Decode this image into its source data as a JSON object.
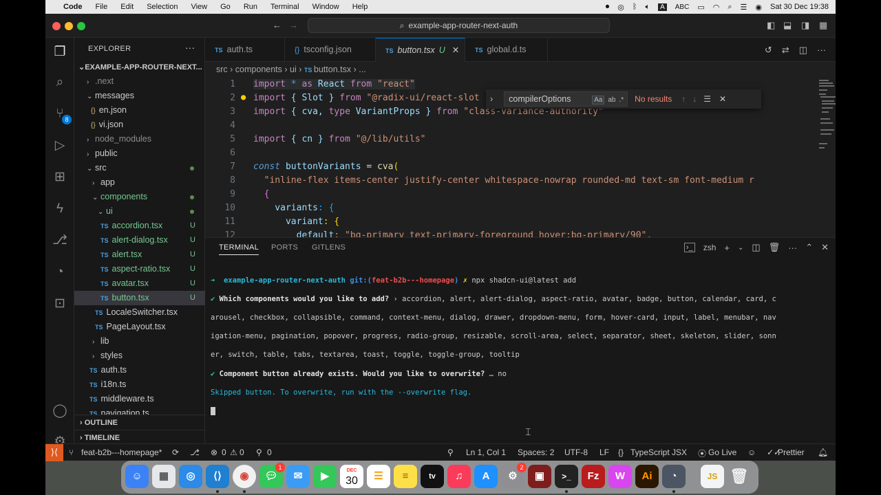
{
  "menubar": {
    "app": "Code",
    "items": [
      "File",
      "Edit",
      "Selection",
      "View",
      "Go",
      "Run",
      "Terminal",
      "Window",
      "Help"
    ],
    "input_source": "ABC",
    "clock": "Sat 30 Dec  19:38"
  },
  "titlebar": {
    "search": "example-app-router-next-auth"
  },
  "activity": {
    "scm_badge": "8"
  },
  "sidebar": {
    "title": "EXPLORER",
    "root": "EXAMPLE-APP-ROUTER-NEXT...",
    "tree": [
      {
        "label": ".next",
        "type": "folder",
        "open": false
      },
      {
        "label": "messages",
        "type": "folder",
        "open": true
      },
      {
        "label": "en.json",
        "type": "json"
      },
      {
        "label": "vi.json",
        "type": "json"
      },
      {
        "label": "node_modules",
        "type": "folder",
        "open": false
      },
      {
        "label": "public",
        "type": "folder",
        "open": false
      },
      {
        "label": "src",
        "type": "folder",
        "open": true
      },
      {
        "label": "app",
        "type": "folder",
        "open": false
      },
      {
        "label": "components",
        "type": "folder",
        "open": true
      },
      {
        "label": "ui",
        "type": "folder",
        "open": true
      },
      {
        "label": "accordion.tsx",
        "type": "ts",
        "status": "U"
      },
      {
        "label": "alert-dialog.tsx",
        "type": "ts",
        "status": "U"
      },
      {
        "label": "alert.tsx",
        "type": "ts",
        "status": "U"
      },
      {
        "label": "aspect-ratio.tsx",
        "type": "ts",
        "status": "U"
      },
      {
        "label": "avatar.tsx",
        "type": "ts",
        "status": "U"
      },
      {
        "label": "button.tsx",
        "type": "ts",
        "status": "U"
      },
      {
        "label": "LocaleSwitcher.tsx",
        "type": "ts"
      },
      {
        "label": "PageLayout.tsx",
        "type": "ts"
      },
      {
        "label": "lib",
        "type": "folder",
        "open": false
      },
      {
        "label": "styles",
        "type": "folder",
        "open": false
      },
      {
        "label": "auth.ts",
        "type": "ts"
      },
      {
        "label": "i18n.ts",
        "type": "ts"
      },
      {
        "label": "middleware.ts",
        "type": "ts"
      },
      {
        "label": "navigation.ts",
        "type": "ts"
      }
    ],
    "outline": "OUTLINE",
    "timeline": "TIMELINE"
  },
  "tabs": [
    {
      "icon": "TS",
      "label": "auth.ts"
    },
    {
      "icon": "{}",
      "label": "tsconfig.json"
    },
    {
      "icon": "TS",
      "label": "button.tsx",
      "status": "U",
      "close": "✕"
    },
    {
      "icon": "TS",
      "label": "global.d.ts"
    }
  ],
  "breadcrumb": [
    "src",
    "components",
    "ui",
    "button.tsx",
    "..."
  ],
  "find": {
    "query": "compilerOptions",
    "opt_case": "Aa",
    "opt_word": "ab",
    "opt_regex": ".*",
    "result": "No results"
  },
  "code_lines": [
    "1",
    "2",
    "3",
    "4",
    "5",
    "6",
    "7",
    "8",
    "9",
    "10",
    "11",
    "12"
  ],
  "code": {
    "l1a": "import",
    "l1b": " * ",
    "l1c": "as",
    "l1d": " React ",
    "l1e": "from",
    "l1f": " \"react\"",
    "l2a": "import",
    "l2b": " { Slot } ",
    "l2c": "from",
    "l2d": " \"@radix-ui/react-slot",
    "l3a": "import",
    "l3b": " { cva, ",
    "l3c": "type",
    "l3d": " VariantProps } ",
    "l3e": "from",
    "l3f": " \"class-variance-authority\"",
    "l5a": "import",
    "l5b": " { cn } ",
    "l5c": "from",
    "l5d": " \"@/lib/utils\"",
    "l7a": "const",
    "l7b": " buttonVariants ",
    "l7c": "= ",
    "l7d": "cva",
    "l7e": "(",
    "l8": "  \"inline-flex items-center justify-center whitespace-nowrap rounded-md text-sm font-medium r",
    "l9": "  {",
    "l10a": "    variants",
    "l10b": ": {",
    "l11a": "      variant",
    "l11b": ": {",
    "l12a": "        default",
    "l12b": ": \"bg-primary text-primary-foreground hover:bg-primary/90\","
  },
  "panel": {
    "tabs": [
      "TERMINAL",
      "PORTS",
      "GITLENS"
    ],
    "shell": "zsh"
  },
  "terminal": {
    "prompt_arrow": "➜",
    "dir": "example-app-router-next-auth",
    "git_label": "git:(",
    "branch": "feat-b2b---homepage",
    "git_close": ")",
    "dirty": "✗",
    "cmd": "npx shadcn-ui@latest add",
    "check": "✔",
    "q1": "Which components would you like to add?",
    "a1_line1": "› accordion, alert, alert-dialog, aspect-ratio, avatar, badge, button, calendar, card, c",
    "a1_line2": "arousel, checkbox, collapsible, command, context-menu, dialog, drawer, dropdown-menu, form, hover-card, input, label, menubar, nav",
    "a1_line3": "igation-menu, pagination, popover, progress, radio-group, resizable, scroll-area, select, separator, sheet, skeleton, slider, sonn",
    "a1_line4": "er, switch, table, tabs, textarea, toast, toggle, toggle-group, tooltip",
    "q2": "Component button already exists. Would you like to overwrite?",
    "a2": "… no",
    "skipped": "Skipped button. To overwrite, run with the --overwrite flag."
  },
  "status": {
    "branch": "feat-b2b---homepage*",
    "errors": "0",
    "warnings": "0",
    "ports": "0",
    "position": "Ln 1, Col 1",
    "spaces": "Spaces: 2",
    "encoding": "UTF-8",
    "eol": "LF",
    "language": "TypeScript JSX",
    "golive": "Go Live",
    "prettier": "Prettier"
  },
  "dock": {
    "calendar_month": "DEC",
    "calendar_day": "30",
    "messages_badge": "1",
    "settings_badge": "2",
    "filezilla": "Fz",
    "illustrator": "Ai",
    "js": "JS"
  }
}
